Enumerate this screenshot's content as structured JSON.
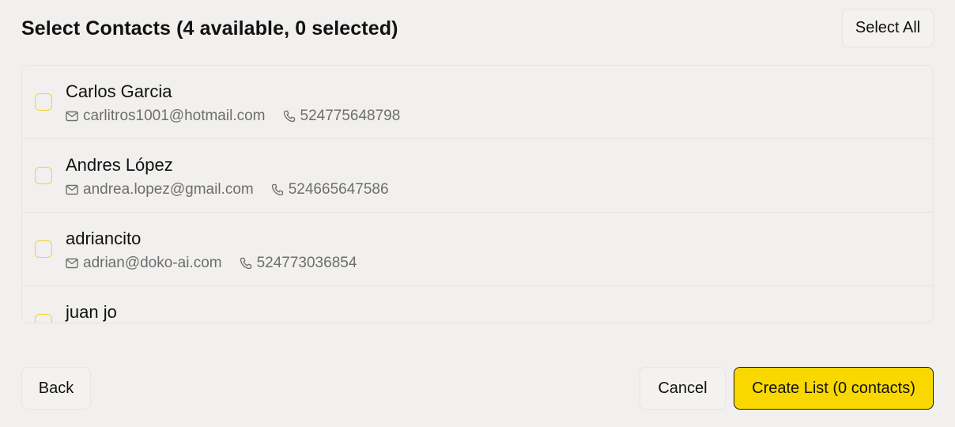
{
  "header": {
    "title": "Select Contacts (4 available, 0 selected)",
    "select_all_label": "Select All"
  },
  "contacts": [
    {
      "name": "Carlos Garcia",
      "email": "carlitros1001@hotmail.com",
      "phone": "524775648798",
      "selected": false
    },
    {
      "name": "Andres López",
      "email": "andrea.lopez@gmail.com",
      "phone": "524665647586",
      "selected": false
    },
    {
      "name": "adriancito",
      "email": "adrian@doko-ai.com",
      "phone": "524773036854",
      "selected": false
    },
    {
      "name": "juan jo",
      "email": "",
      "phone": "",
      "selected": false
    }
  ],
  "footer": {
    "back_label": "Back",
    "cancel_label": "Cancel",
    "create_label": "Create List (0 contacts)"
  },
  "colors": {
    "accent": "#f9d800",
    "checkbox_border": "#f2d233",
    "background": "#f1f0ee"
  },
  "icons": {
    "email": "mail-icon",
    "phone": "phone-icon"
  }
}
